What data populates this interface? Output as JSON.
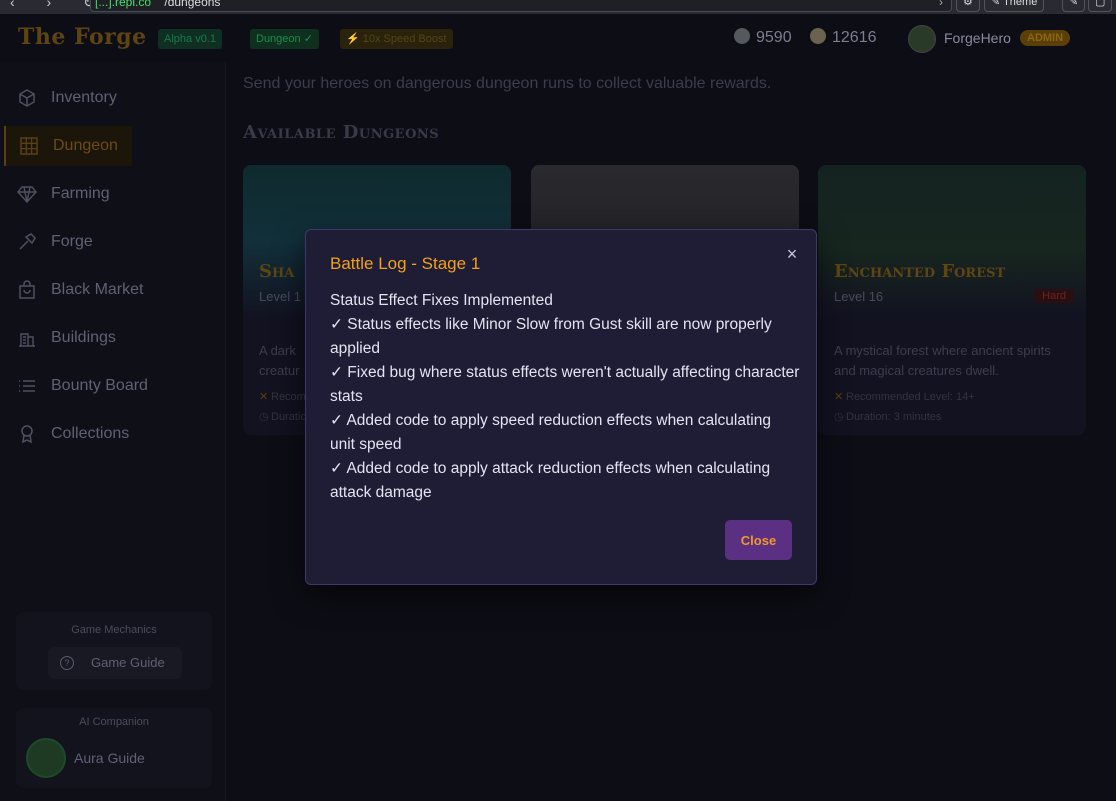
{
  "browser": {
    "domain": "[...].repl.co",
    "path": "/dungeons",
    "theme_label": "Theme"
  },
  "header": {
    "logo": "The Forge",
    "alpha_badge": "Alpha v0.1",
    "dungeon_badge": "Dungeon ✓",
    "speed_badge": "10x Speed Boost",
    "currency1": "9590",
    "currency2": "12616",
    "username": "ForgeHero",
    "role_badge": "ADMIN"
  },
  "sidebar": {
    "items": [
      {
        "label": "Inventory",
        "icon": "cube-icon"
      },
      {
        "label": "Dungeon",
        "icon": "grid-icon"
      },
      {
        "label": "Farming",
        "icon": "gem-icon"
      },
      {
        "label": "Forge",
        "icon": "hammer-icon"
      },
      {
        "label": "Black Market",
        "icon": "bag-icon"
      },
      {
        "label": "Buildings",
        "icon": "building-icon"
      },
      {
        "label": "Bounty Board",
        "icon": "list-icon"
      },
      {
        "label": "Collections",
        "icon": "award-icon"
      }
    ],
    "game_mechanics_title": "Game Mechanics",
    "game_guide_label": "Game Guide",
    "ai_companion_title": "AI Companion",
    "aura_label": "Aura Guide"
  },
  "main": {
    "intro": "Send your heroes on dangerous dungeon runs to collect valuable rewards.",
    "section_title": "Available Dungeons",
    "cards": [
      {
        "title": "Sha",
        "level": "Level 1",
        "desc": "A dark\ncreatur",
        "meta1": "Recom",
        "meta2": "Duratio"
      },
      {
        "title": "",
        "level": "",
        "desc": "",
        "meta1": "",
        "meta2": ""
      },
      {
        "title": "Enchanted Forest",
        "level": "Level 16",
        "difficulty": "Hard",
        "desc": "A mystical forest where ancient spirits and magical creatures dwell.",
        "meta1": "Recommended Level: 14+",
        "meta2": "Duration: 3 minutes"
      }
    ]
  },
  "modal": {
    "title": "Battle Log - Stage 1",
    "lines": [
      "Status Effect Fixes Implemented",
      "✓ Status effects like Minor Slow from Gust skill are now properly applied",
      "✓ Fixed bug where status effects weren't actually affecting character stats",
      "✓ Added code to apply speed reduction effects when calculating unit speed",
      "✓ Added code to apply attack reduction effects when calculating attack damage"
    ],
    "close_label": "Close",
    "close_x": "×"
  },
  "colors": {
    "accent": "#f2a11a",
    "modal_bg": "#1f1d35",
    "button_bg": "#5b2f82"
  }
}
